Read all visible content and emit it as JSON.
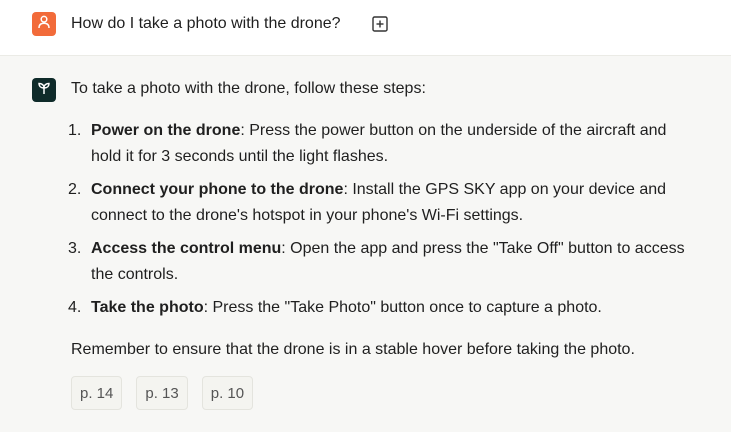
{
  "user": {
    "question": "How do I take a photo with the drone?"
  },
  "answer": {
    "intro": "To take a photo with the drone, follow these steps:",
    "steps": [
      {
        "number": "1.",
        "title": "Power on the drone",
        "text": ": Press the power button on the underside of the aircraft and hold it for 3 seconds until the light flashes."
      },
      {
        "number": "2.",
        "title": "Connect your phone to the drone",
        "text": ": Install the GPS SKY app on your device and connect to the drone's hotspot in your phone's Wi-Fi settings."
      },
      {
        "number": "3.",
        "title": "Access the control menu",
        "text": ": Open the app and press the \"Take Off\" button to access the controls."
      },
      {
        "number": "4.",
        "title": "Take the photo",
        "text": ": Press the \"Take Photo\" button once to capture a photo."
      }
    ],
    "outro": "Remember to ensure that the drone is in a stable hover before taking the photo.",
    "references": [
      "p. 14",
      "p. 13",
      "p. 10"
    ]
  },
  "icons": {
    "user_avatar": "person-icon",
    "bot_avatar": "sprout-icon",
    "add": "plus-square-icon"
  },
  "colors": {
    "user_avatar_bg": "#f26b3a",
    "bot_avatar_bg": "#0f2b2a",
    "answer_bg": "#f7f7f5"
  }
}
